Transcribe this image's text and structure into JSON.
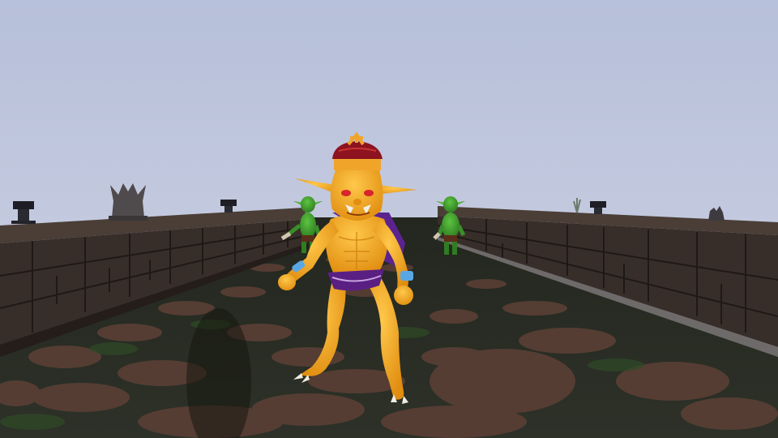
{
  "scene": {
    "sky_color": "#bac3dc",
    "wall_color": "#3a302b",
    "ground_color": "#2e322a",
    "stone_color": "#5a3f35",
    "moss_color": "#2f4a26"
  },
  "characters": {
    "goblin_king": {
      "skin_color": "#f2a41c",
      "crown_color": "#8d1320",
      "loincloth_color": "#5a1f83",
      "cape_color": "#5b2390",
      "wristband_color": "#5aa7e6"
    },
    "goblin_minion": {
      "skin_color": "#3f9e2d"
    }
  },
  "icons": {
    "statue": "gargoyle-statue-icon",
    "brazier": "brazier-icon"
  }
}
